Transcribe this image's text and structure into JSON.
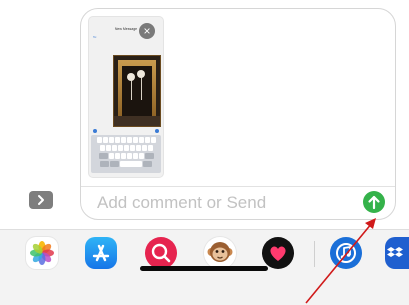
{
  "compose": {
    "placeholder": "Add comment or Send"
  },
  "thumbnail": {
    "title": "New Message",
    "subtitle": "To:"
  },
  "apps_button_icon": "chevron-right-icon",
  "send_button_icon": "arrow-up-icon",
  "dock": {
    "apps": [
      {
        "name": "photos",
        "icon": "photos-flower-icon"
      },
      {
        "name": "app-store",
        "icon": "app-store-icon"
      },
      {
        "name": "images-search",
        "icon": "globe-search-icon"
      },
      {
        "name": "animoji",
        "icon": "monkey-face-icon"
      },
      {
        "name": "digital-touch",
        "icon": "heart-icon"
      },
      {
        "name": "music",
        "icon": "music-circle-icon"
      },
      {
        "name": "partial-app",
        "icon": "dropbox-icon"
      }
    ]
  },
  "colors": {
    "send_green": "#34b24a",
    "annotation_arrow": "#d01a1a"
  }
}
